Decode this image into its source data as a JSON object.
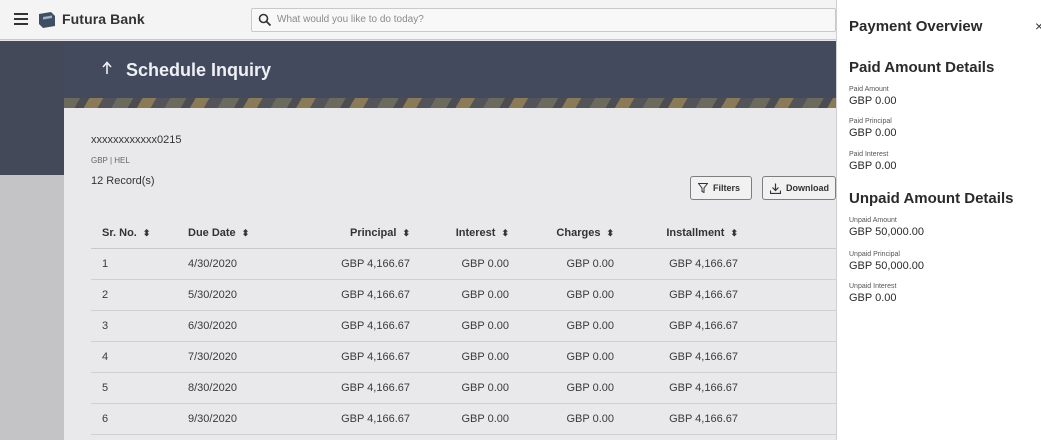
{
  "topbar": {
    "brand": "Futura Bank",
    "search_placeholder": "What would you like to do today?"
  },
  "page": {
    "title": "Schedule Inquiry",
    "account_number": "xxxxxxxxxxxx0215",
    "account_sub": "GBP | HEL",
    "records": "12 Record(s)",
    "filters_label": "Filters",
    "download_label": "Download"
  },
  "table": {
    "headers": [
      "Sr. No.",
      "Due Date",
      "Principal",
      "Interest",
      "Charges",
      "Installment"
    ],
    "rows": [
      [
        "1",
        "4/30/2020",
        "GBP 4,166.67",
        "GBP 0.00",
        "GBP 0.00",
        "GBP 4,166.67"
      ],
      [
        "2",
        "5/30/2020",
        "GBP 4,166.67",
        "GBP 0.00",
        "GBP 0.00",
        "GBP 4,166.67"
      ],
      [
        "3",
        "6/30/2020",
        "GBP 4,166.67",
        "GBP 0.00",
        "GBP 0.00",
        "GBP 4,166.67"
      ],
      [
        "4",
        "7/30/2020",
        "GBP 4,166.67",
        "GBP 0.00",
        "GBP 0.00",
        "GBP 4,166.67"
      ],
      [
        "5",
        "8/30/2020",
        "GBP 4,166.67",
        "GBP 0.00",
        "GBP 0.00",
        "GBP 4,166.67"
      ],
      [
        "6",
        "9/30/2020",
        "GBP 4,166.67",
        "GBP 0.00",
        "GBP 0.00",
        "GBP 4,166.67"
      ]
    ]
  },
  "overview": {
    "title": "Payment Overview",
    "close": "×",
    "paid": {
      "heading": "Paid Amount Details",
      "paid_amount_label": "Paid Amount",
      "paid_amount_value": "GBP 0.00",
      "paid_principal_label": "Paid Principal",
      "paid_principal_value": "GBP 0.00",
      "paid_interest_label": "Paid Interest",
      "paid_interest_value": "GBP 0.00"
    },
    "unpaid": {
      "heading": "Unpaid Amount Details",
      "unpaid_amount_label": "Unpaid Amount",
      "unpaid_amount_value": "GBP 50,000.00",
      "unpaid_principal_label": "Unpaid Principal",
      "unpaid_principal_value": "GBP 50,000.00",
      "unpaid_interest_label": "Unpaid Interest",
      "unpaid_interest_value": "GBP 0.00"
    }
  },
  "icons": {
    "menu": "hamburger-icon",
    "logo": "bank-logo-icon",
    "search": "search-icon",
    "back": "back-arrow-icon",
    "sort": "sort-icon",
    "filter": "filter-icon",
    "download": "download-icon",
    "close": "close-icon"
  },
  "colors": {
    "banner": "#434a5e",
    "overlay_bg": "#ffffff",
    "dim": "#8f8f94"
  }
}
